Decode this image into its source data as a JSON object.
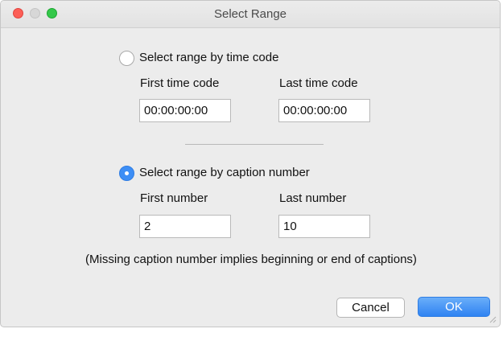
{
  "window": {
    "title": "Select Range"
  },
  "timecode_section": {
    "radio_label": "Select range by time code",
    "selected": false,
    "first_label": "First time code",
    "last_label": "Last time code",
    "first_value": "00:00:00:00",
    "last_value": "00:00:00:00"
  },
  "caption_section": {
    "radio_label": "Select range by caption number",
    "selected": true,
    "first_label": "First number",
    "last_label": "Last number",
    "first_value": "2",
    "last_value": "10"
  },
  "note": "(Missing caption number implies beginning or end of captions)",
  "buttons": {
    "cancel": "Cancel",
    "ok": "OK"
  },
  "colors": {
    "accent": "#3d8ef5",
    "close": "#fc5f57",
    "zoom": "#34c84a"
  }
}
